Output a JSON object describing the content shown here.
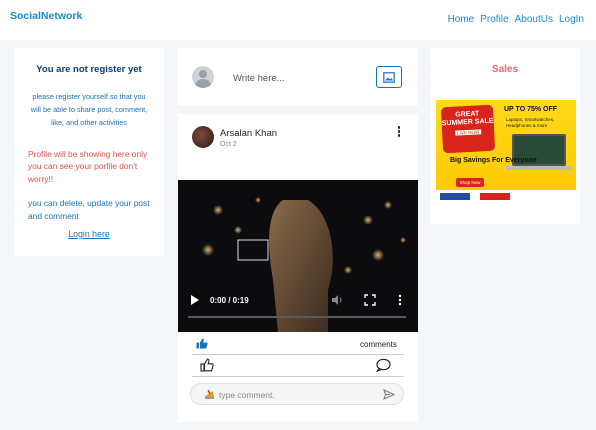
{
  "navbar": {
    "brand": "SocialNetwork",
    "links": [
      "Home",
      "Profile",
      "AboutUs",
      "LogIn"
    ]
  },
  "left_card": {
    "title": "You are not register yet",
    "description": "please register yourself so that you will be able to share post, comment, like, and other activities",
    "red_note": "Profile will be showing here only you can see your porfile don't worry!!",
    "blue_note": "you can delete, update your post and comment",
    "login_link": "Login here"
  },
  "composer": {
    "placeholder": "Write here..."
  },
  "post": {
    "author": "Arsalan Khan",
    "date": "Oct 2",
    "video": {
      "time": "0:00 / 0:19",
      "progress": 0.0
    },
    "comments_label": "comments",
    "comment_placeholder": "type comment."
  },
  "sales": {
    "title": "Sales",
    "ad": {
      "badge_line1": "GREAT SUMMER SALE",
      "badge_line2": "LIVE NOW",
      "upto": "UP TO 75% OFF",
      "items": "Laptops, Smartwatches, Headphones & more",
      "big_savings": "Big Savings For Everyone",
      "cta": "Shop Now"
    }
  },
  "colors": {
    "brand_blue": "#1a8ccf",
    "link_blue": "#1a73b8",
    "warning_red": "#e0534a",
    "sales_red": "#e26a6a",
    "background": "#f4f6fa"
  }
}
